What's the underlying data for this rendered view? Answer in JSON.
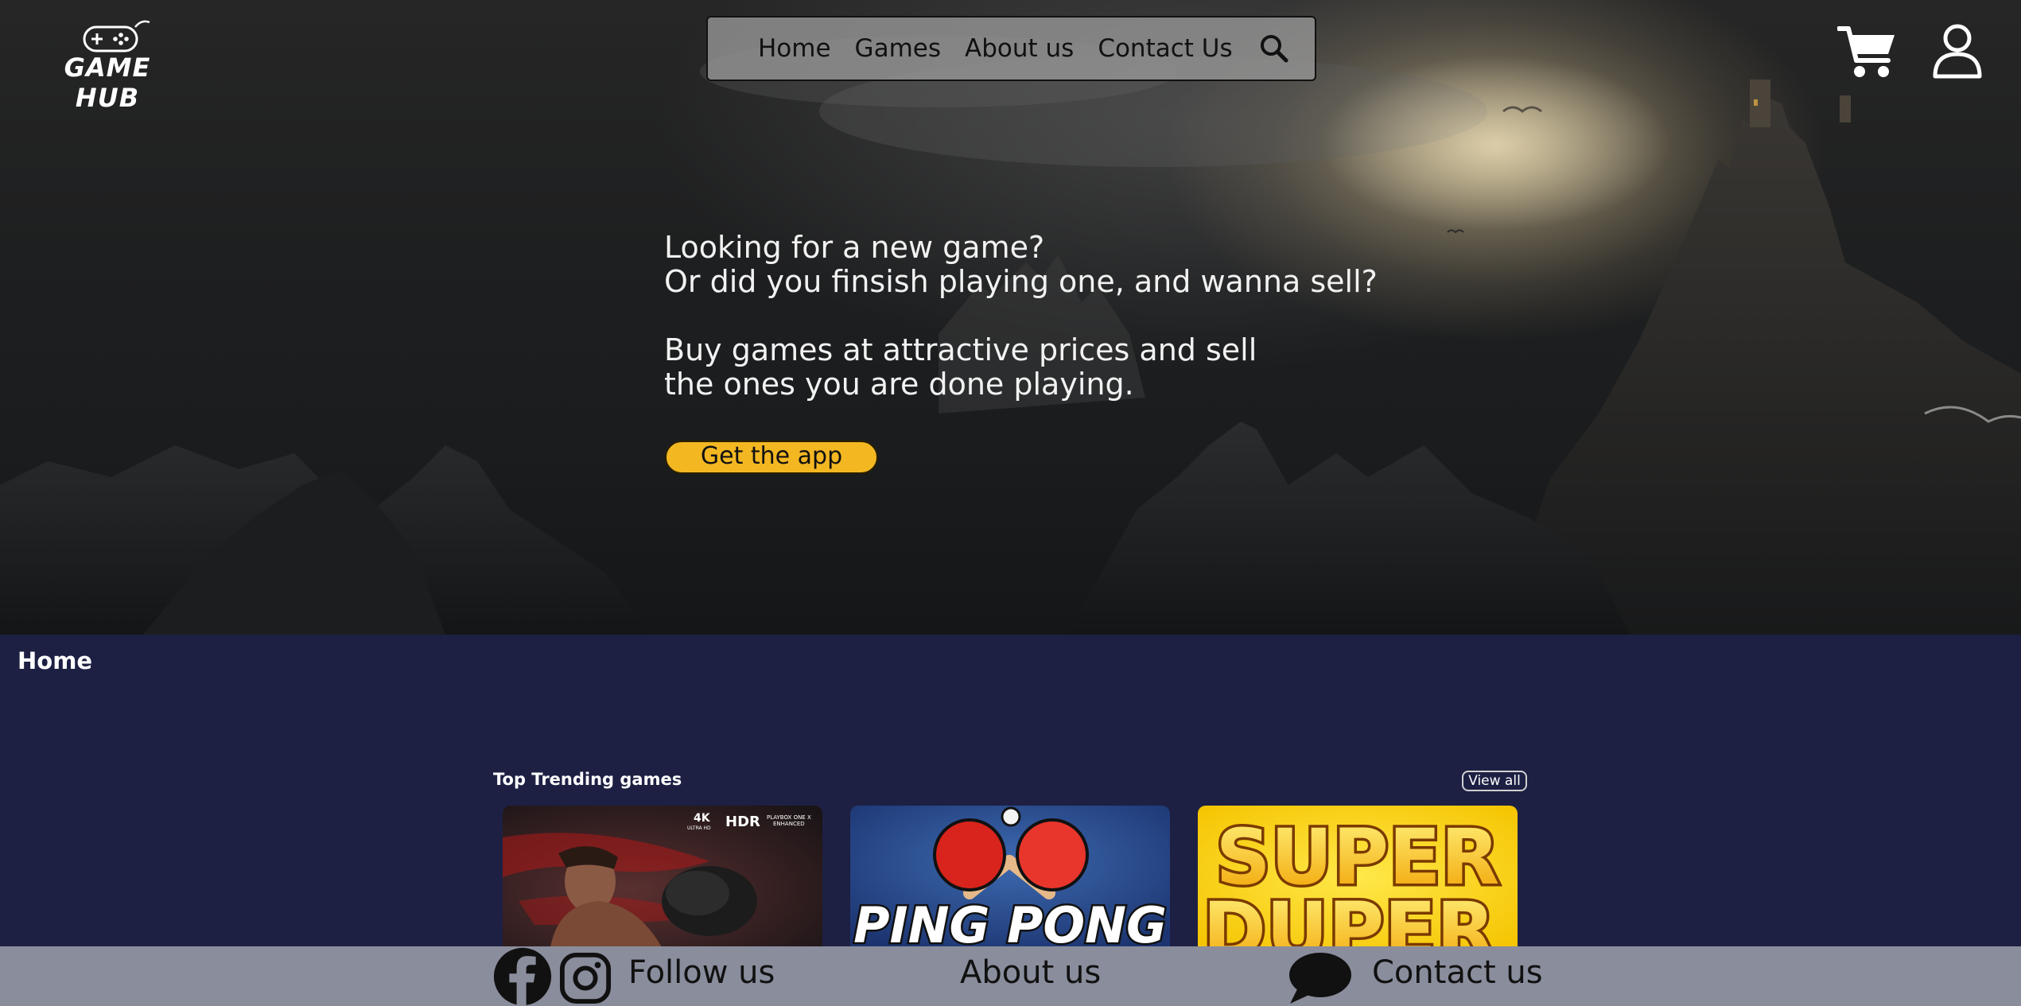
{
  "header": {
    "logo_text": "GAME HUB",
    "nav": [
      "Home",
      "Games",
      "About us",
      "Contact Us"
    ]
  },
  "hero": {
    "line1": "Looking for a new game?",
    "line2": "Or did you finsish playing one, and wanna sell?",
    "line3": "Buy games at attractive prices and sell",
    "line4": "the ones you are done playing.",
    "cta_label": "Get the app"
  },
  "home": {
    "label": "Home",
    "trending_title": "Top Trending games",
    "view_all_label": "View all",
    "cards": [
      {
        "badge_4k": "4K",
        "badge_uhd": "ULTRA HD",
        "badge_hdr": "HDR",
        "badge_xbox_1": "PLAYBOX ONE X",
        "badge_xbox_2": "ENHANCED"
      },
      {
        "title": "PING PONG"
      },
      {
        "title_1": "SUPER",
        "title_2": "DUPER"
      }
    ]
  },
  "footer": {
    "follow_label": "Follow us",
    "about_label": "About us",
    "contact_label": "Contact us"
  },
  "colors": {
    "accent": "#f3b722",
    "page_bg": "#1d2043",
    "footer_bg": "#8a8d9c",
    "nav_bg": "#969696"
  }
}
